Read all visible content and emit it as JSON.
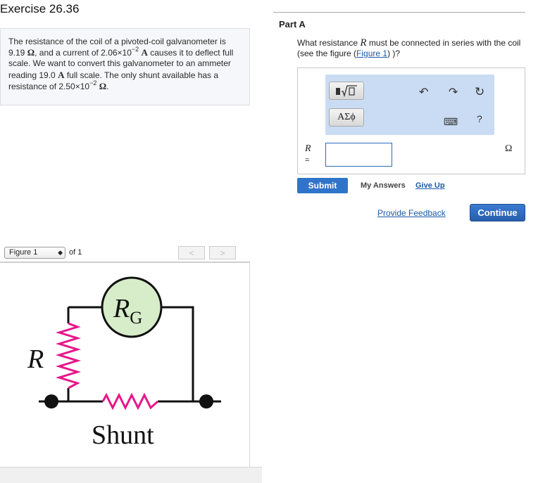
{
  "exercise_title": "Exercise 26.36",
  "problem": {
    "t1": "The resistance of the coil of a pivoted-coil galvanometer is 9.19",
    "ohm": "Ω",
    "t2": ", and a current of 2.06×10",
    "exp1": "−2",
    "amp": "A",
    "t3": "causes it to deflect full scale. We want to convert this galvanometer to an ammeter reading 19.0",
    "t4": "full scale. The only shunt available has a resistance of 2.50×10",
    "exp2": "−2",
    "t5": "."
  },
  "part": {
    "title": "Part A",
    "q1": "What resistance",
    "q_var": "R",
    "q2": "must be connected in series with the coil (see the figure (",
    "q_link": "Figure 1",
    "q3": ") )?"
  },
  "toolbar": {
    "template_btn": "■√□",
    "greek_btn": "ΑΣϕ",
    "undo_icon": "↶",
    "redo_icon": "↷",
    "reset_icon": "↻",
    "keyboard_icon": "⌨",
    "help_label": "?"
  },
  "answer": {
    "var_label": "R",
    "eq": "=",
    "value": "",
    "unit": "Ω"
  },
  "actions": {
    "submit": "Submit",
    "my_answers": "My Answers",
    "give_up": "Give Up",
    "feedback": "Provide Feedback",
    "continue": "Continue"
  },
  "figure_nav": {
    "selected": "Figure 1",
    "of": "of 1",
    "prev": "<",
    "next": ">"
  },
  "figure": {
    "galvanometer_label": "R",
    "galvanometer_sub": "G",
    "resistor_label": "R",
    "shunt_label": "Shunt",
    "colors": {
      "galv_fill": "#d7ecc9",
      "resistor": "#e8158a",
      "wire": "#111111"
    }
  }
}
